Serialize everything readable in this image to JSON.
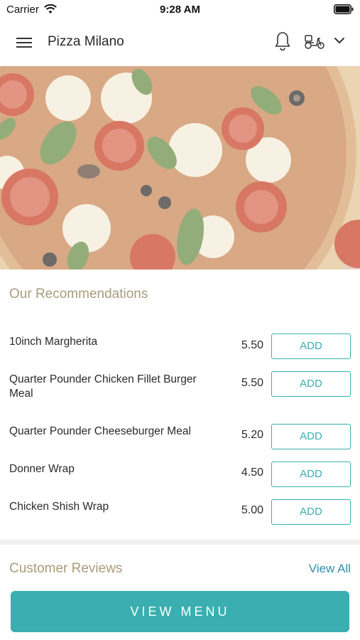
{
  "status_bar": {
    "carrier": "Carrier",
    "time": "9:28 AM"
  },
  "header": {
    "title": "Pizza Milano"
  },
  "recommendations": {
    "title": "Our Recommendations",
    "items": [
      {
        "name": "10inch Margherita",
        "price": "5.50",
        "button": "ADD"
      },
      {
        "name": "Quarter Pounder Chicken Fillet Burger Meal",
        "price": "5.50",
        "button": "ADD"
      },
      {
        "name": "Quarter Pounder Cheeseburger Meal",
        "price": "5.20",
        "button": "ADD"
      },
      {
        "name": "Donner Wrap",
        "price": "4.50",
        "button": "ADD"
      },
      {
        "name": "Chicken Shish Wrap",
        "price": "5.00",
        "button": "ADD"
      }
    ]
  },
  "reviews": {
    "title": "Customer Reviews",
    "view_all": "View All"
  },
  "footer": {
    "view_menu": "VIEW MENU"
  },
  "icons": [
    "wifi-icon",
    "battery-icon",
    "hamburger-menu-icon",
    "bell-icon",
    "delivery-scooter-icon",
    "chevron-down-icon"
  ],
  "colors": {
    "accent": "#3aaeb0",
    "section_title": "#a99c7a",
    "link": "#2f8fae"
  }
}
